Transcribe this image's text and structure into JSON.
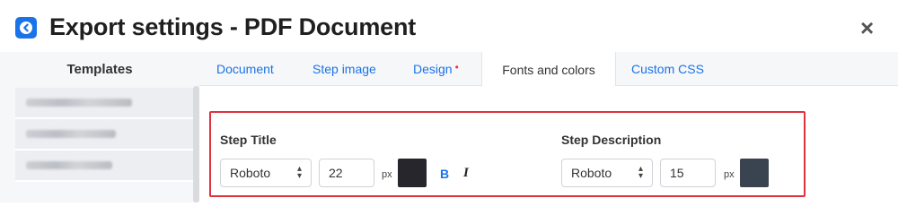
{
  "header": {
    "title": "Export settings - PDF Document",
    "back_icon": "arrow-left-circle-icon",
    "close_icon": "close-icon",
    "close_glyph": "×",
    "accent": "#1a73e8"
  },
  "sidebar": {
    "header": "Templates",
    "items": [
      {
        "label_obscured": true
      },
      {
        "label_obscured": true
      },
      {
        "label_obscured": true
      }
    ]
  },
  "tabs": [
    {
      "label": "Document",
      "active": false
    },
    {
      "label": "Step image",
      "active": false
    },
    {
      "label": "Design",
      "active": false,
      "modified_marker": "•"
    },
    {
      "label": "Fonts and colors",
      "active": true
    },
    {
      "label": "Custom CSS",
      "active": false
    }
  ],
  "step_title": {
    "label": "Step Title",
    "font": "Roboto",
    "size": "22",
    "unit": "px",
    "color": "#26262c",
    "bold_label": "B",
    "italic_label": "I"
  },
  "step_description": {
    "label": "Step Description",
    "font": "Roboto",
    "size": "15",
    "unit": "px",
    "color": "#3a4350"
  },
  "highlight_color": "#e0313f"
}
